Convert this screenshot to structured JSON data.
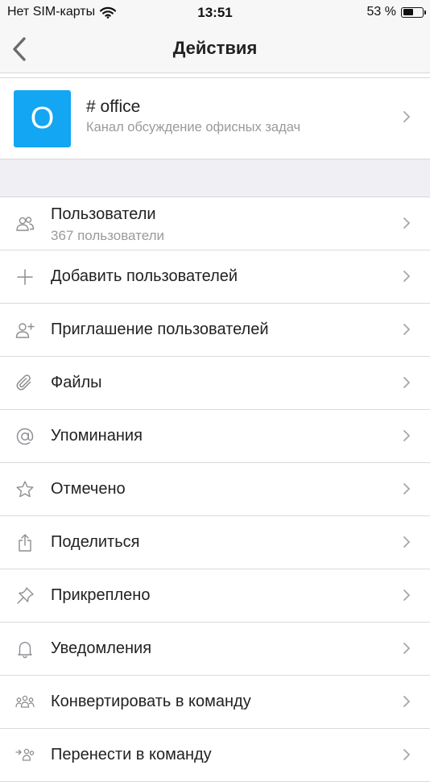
{
  "status_bar": {
    "carrier": "Нет SIM-карты",
    "time": "13:51",
    "battery_text": "53 %",
    "battery_level": 0.53
  },
  "nav": {
    "title": "Действия",
    "back_icon": "chevron-left-icon"
  },
  "channel": {
    "avatar_letter": "O",
    "avatar_color": "#13a6f2",
    "name": "# office",
    "description": "Канал обсуждение офисных задач"
  },
  "actions": [
    {
      "label": "Пользователи",
      "sub": "367 пользователи",
      "icon": "users-icon"
    },
    {
      "label": "Добавить пользователей",
      "icon": "plus-icon"
    },
    {
      "label": "Приглашение пользователей",
      "icon": "invite-user-icon"
    },
    {
      "label": "Файлы",
      "icon": "paperclip-icon"
    },
    {
      "label": "Упоминания",
      "icon": "at-icon"
    },
    {
      "label": "Отмечено",
      "icon": "star-icon"
    },
    {
      "label": "Поделиться",
      "icon": "share-icon"
    },
    {
      "label": "Прикреплено",
      "icon": "pin-icon"
    },
    {
      "label": "Уведомления",
      "icon": "bell-icon"
    },
    {
      "label": "Конвертировать в команду",
      "icon": "team-icon"
    },
    {
      "label": "Перенести в команду",
      "icon": "move-to-team-icon"
    }
  ]
}
